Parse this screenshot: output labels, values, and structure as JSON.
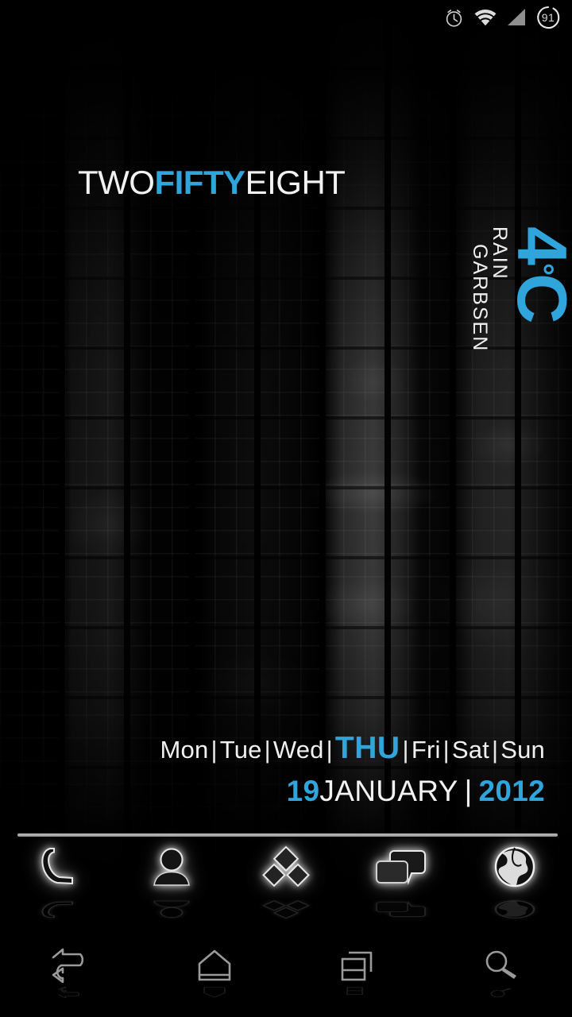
{
  "theme": {
    "accent_color": "#2FA5DB",
    "text_color": "#F2F2F2",
    "background_color": "#000000"
  },
  "status_bar": {
    "alarm_icon": "alarm-clock-icon",
    "wifi_icon": "wifi-icon",
    "signal_icon": "cell-signal-icon",
    "battery_icon": "battery-circle-icon",
    "battery_level": "91"
  },
  "clock_widget": {
    "hour_word": "TWO",
    "minute_word_tens": "FIFTY",
    "minute_word_ones": "EIGHT"
  },
  "weather_widget": {
    "condition": "RAIN",
    "location": "GARBSEN",
    "temperature": "4",
    "degree_symbol": "°",
    "unit": "C"
  },
  "date_widget": {
    "days": [
      {
        "label": "Mon",
        "active": false
      },
      {
        "label": "Tue",
        "active": false
      },
      {
        "label": "Wed",
        "active": false
      },
      {
        "label": "THU",
        "active": true
      },
      {
        "label": "Fri",
        "active": false
      },
      {
        "label": "Sat",
        "active": false
      },
      {
        "label": "Sun",
        "active": false
      }
    ],
    "separator": "|",
    "day_number": "19",
    "month": "JANUARY",
    "date_separator": "|",
    "year": "2012"
  },
  "dock": {
    "items": [
      {
        "name": "phone",
        "icon": "phone-handset-icon"
      },
      {
        "name": "contacts",
        "icon": "person-icon"
      },
      {
        "name": "app-drawer",
        "icon": "diamonds-grid-icon"
      },
      {
        "name": "messaging",
        "icon": "speech-bubbles-icon"
      },
      {
        "name": "browser",
        "icon": "globe-icon"
      }
    ]
  },
  "nav_bar": {
    "items": [
      {
        "name": "back",
        "icon": "back-arrow-icon"
      },
      {
        "name": "home",
        "icon": "home-icon"
      },
      {
        "name": "recents",
        "icon": "recent-apps-icon"
      },
      {
        "name": "search",
        "icon": "search-icon"
      }
    ]
  }
}
